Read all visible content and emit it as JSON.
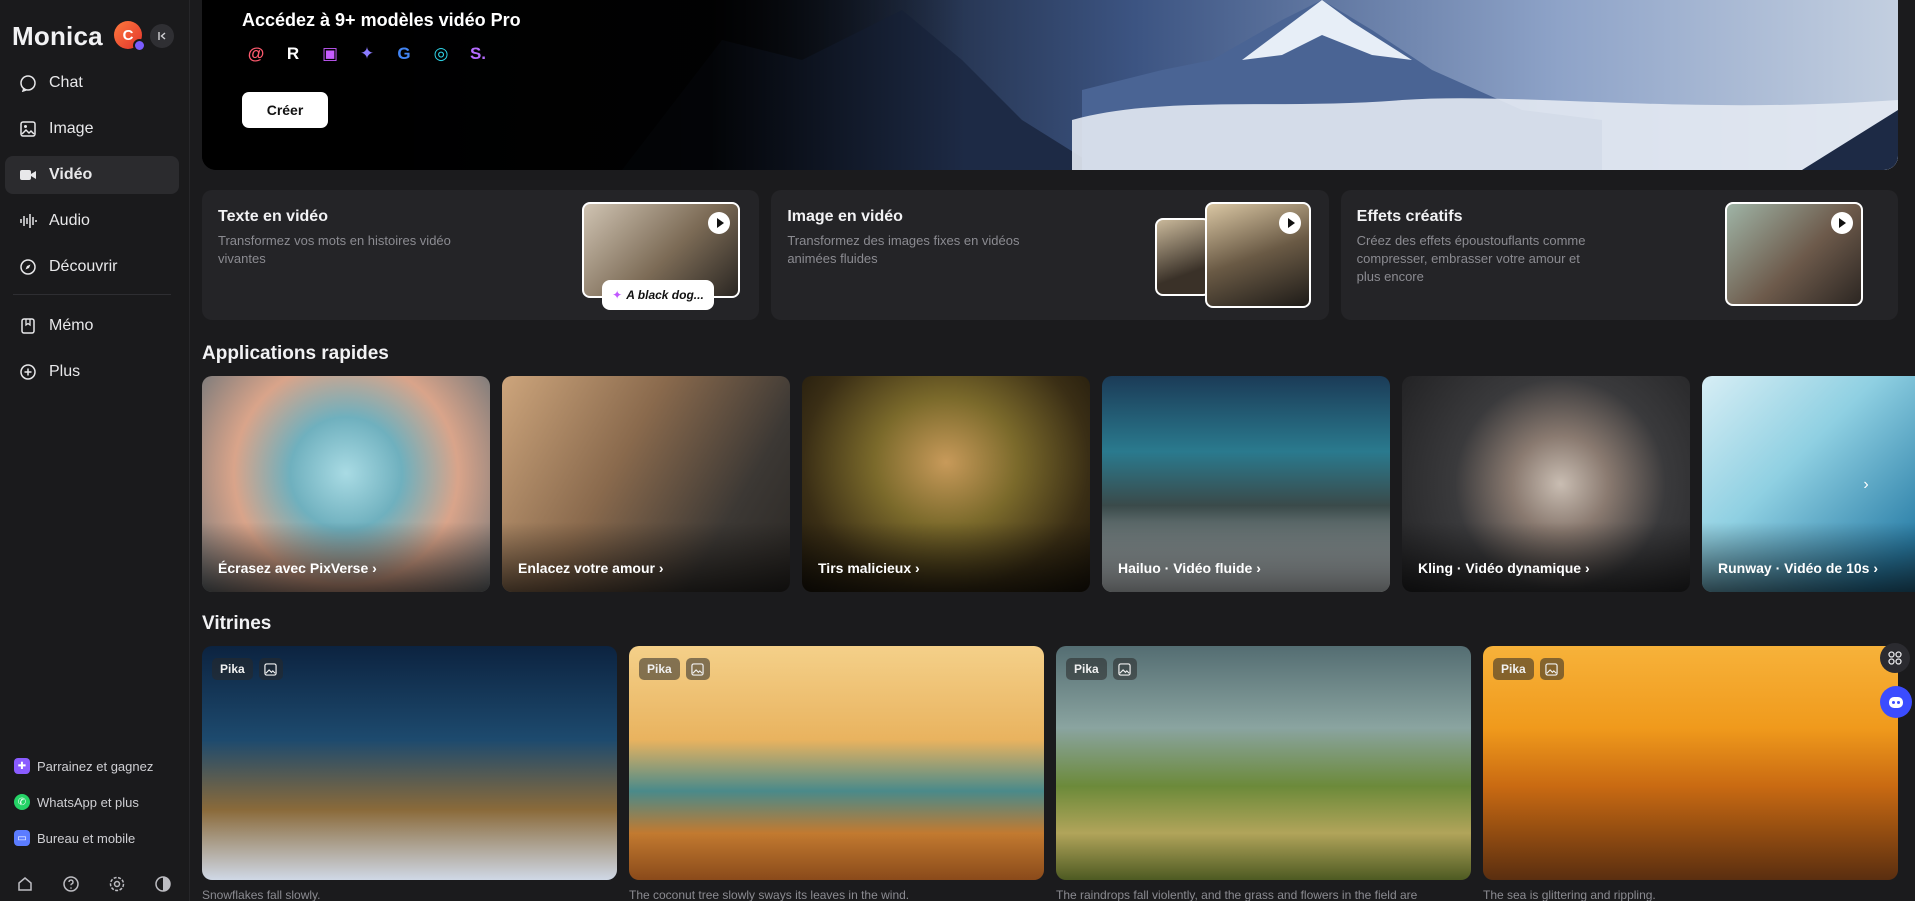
{
  "sidebar": {
    "brand": "Monica",
    "avatar_initial": "C",
    "nav": [
      {
        "label": "Chat",
        "icon": "chat-icon"
      },
      {
        "label": "Image",
        "icon": "image-icon"
      },
      {
        "label": "Vidéo",
        "icon": "video-icon",
        "active": true
      },
      {
        "label": "Audio",
        "icon": "audio-icon"
      },
      {
        "label": "Découvrir",
        "icon": "compass-icon"
      },
      {
        "label": "Mémo",
        "icon": "bookmark-icon"
      },
      {
        "label": "Plus",
        "icon": "plus-circle-icon"
      }
    ],
    "promos": [
      {
        "label": "Parrainez et gagnez",
        "icon": "gift-icon",
        "color": "#8a5cff"
      },
      {
        "label": "WhatsApp et plus",
        "icon": "whatsapp-icon",
        "color": "#25d366"
      },
      {
        "label": "Bureau et mobile",
        "icon": "devices-icon",
        "color": "#5b7cff"
      }
    ],
    "bottom_icons": [
      "home-icon",
      "help-icon",
      "settings-icon",
      "theme-icon"
    ]
  },
  "hero": {
    "title": "Accédez à 9+ modèles vidéo Pro",
    "button": "Créer",
    "logos": [
      {
        "icon": "model-logo-1",
        "glyph": "@",
        "color": "#ff5a6e"
      },
      {
        "icon": "model-logo-2",
        "glyph": "R",
        "color": "#ffffff"
      },
      {
        "icon": "model-logo-3",
        "glyph": "▣",
        "color": "#c75cff"
      },
      {
        "icon": "model-logo-4",
        "glyph": "✦",
        "color": "#8b7bff"
      },
      {
        "icon": "model-logo-5",
        "glyph": "G",
        "color": "#4285f4"
      },
      {
        "icon": "model-logo-6",
        "glyph": "◎",
        "color": "#2fd5e8"
      },
      {
        "icon": "model-logo-7",
        "glyph": "S.",
        "color": "#b56cff"
      }
    ]
  },
  "features": [
    {
      "title": "Texte en vidéo",
      "desc": "Transformez vos mots en histoires vidéo vivantes",
      "prompt": "A black dog..."
    },
    {
      "title": "Image en vidéo",
      "desc": "Transformez des images fixes en vidéos animées fluides"
    },
    {
      "title": "Effets créatifs",
      "desc": "Créez des effets époustouflants comme compresser, embrasser votre amour et plus encore"
    }
  ],
  "apps_title": "Applications rapides",
  "apps": [
    {
      "label": "Écrasez avec PixVerse",
      "c1": "#8cc7d2",
      "c2": "#e3a98c"
    },
    {
      "label": "Enlacez votre amour",
      "c1": "#c8a27a",
      "c2": "#3d3a36"
    },
    {
      "label": "Tirs malicieux",
      "c1": "#7b6a2b",
      "c2": "#2b2212"
    },
    {
      "label": "Hailuo · Vidéo fluide",
      "c1": "#2a6a86",
      "c2": "#cfd6da"
    },
    {
      "label": "Kling · Vidéo dynamique",
      "c1": "#3a3a3c",
      "c2": "#9a8a80"
    },
    {
      "label": "Runway · Vidéo de 10s",
      "c1": "#9fd6e6",
      "c2": "#2b7fa8"
    }
  ],
  "showcase_title": "Vitrines",
  "showcase": [
    {
      "tag": "Pika",
      "caption": "Snowflakes fall slowly.",
      "c1": "#0f2a44",
      "c2": "#d9b071"
    },
    {
      "tag": "Pika",
      "caption": "The coconut tree slowly sways its leaves in the wind.",
      "c1": "#f1c674",
      "c2": "#b56a22"
    },
    {
      "tag": "Pika",
      "caption": "The raindrops fall violently, and the grass and flowers in the field are",
      "c1": "#6d8a8c",
      "c2": "#6f7d2c"
    },
    {
      "tag": "Pika",
      "caption": "The sea is glittering and rippling.",
      "c1": "#f5a524",
      "c2": "#7a3a10"
    }
  ]
}
